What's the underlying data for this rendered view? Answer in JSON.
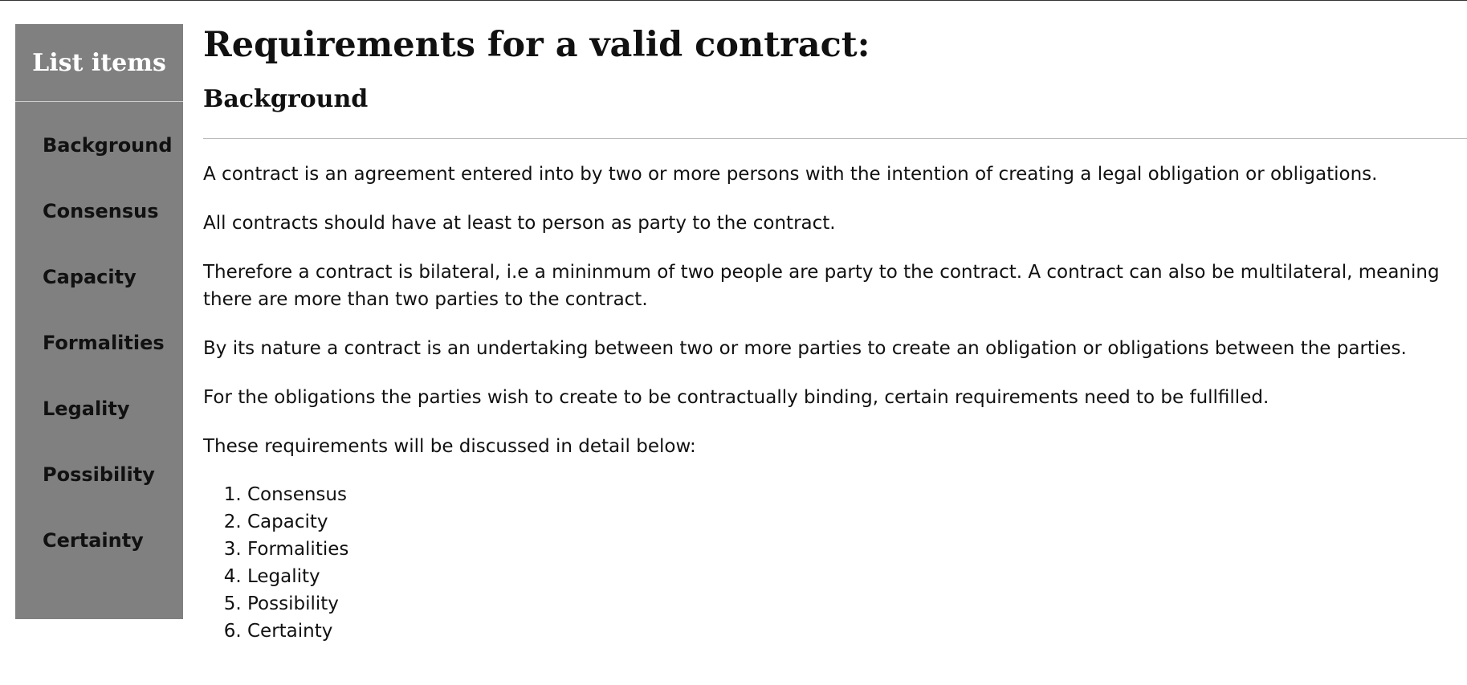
{
  "sidebar": {
    "title": "List items",
    "items": [
      {
        "label": "Background"
      },
      {
        "label": "Consensus"
      },
      {
        "label": "Capacity"
      },
      {
        "label": "Formalities"
      },
      {
        "label": "Legality"
      },
      {
        "label": "Possibility"
      },
      {
        "label": "Certainty"
      }
    ]
  },
  "main": {
    "title": "Requirements for a valid contract:",
    "section_heading": "Background",
    "paragraphs": [
      "A contract is an agreement entered into by two or more persons with the intention of creating a legal obligation or obligations.",
      "All contracts should have at least to person as party to the contract.",
      "Therefore a contract is bilateral, i.e a mininmum of two people are party to the contract. A contract can also be multilateral, meaning there are more than two parties to the contract.",
      "By its nature a contract is an undertaking between two or more parties to create an obligation or obligations between the parties.",
      "For the obligations the parties wish to create to be contractually binding, certain requirements need to be fullfilled.",
      "These requirements will be discussed in detail below:"
    ],
    "requirements": [
      "Consensus",
      "Capacity",
      "Formalities",
      "Legality",
      "Possibility",
      "Certainty"
    ]
  }
}
